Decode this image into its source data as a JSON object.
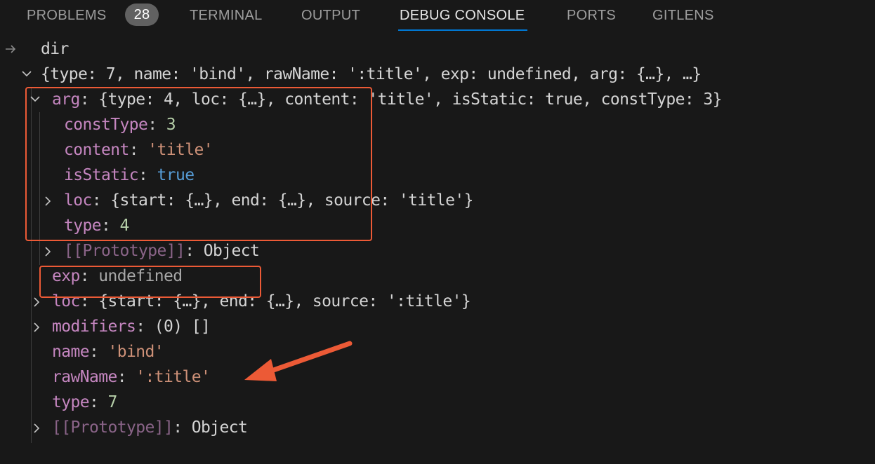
{
  "tabs": [
    {
      "label": "PROBLEMS",
      "badge": "28"
    },
    {
      "label": "TERMINAL"
    },
    {
      "label": "OUTPUT"
    },
    {
      "label": "DEBUG CONSOLE",
      "active": true
    },
    {
      "label": "PORTS"
    },
    {
      "label": "GITLENS"
    }
  ],
  "console": {
    "input": "dir",
    "lines": {
      "root": "{type: 7, name: 'bind', rawName: ':title', exp: undefined, arg: {…}, …}",
      "arg_key": "arg",
      "arg_summary": "{type: 4, loc: {…}, content: 'title', isStatic: true, constType: 3}",
      "arg_constType_key": "constType",
      "arg_constType_val": "3",
      "arg_content_key": "content",
      "arg_content_val": "'title'",
      "arg_isStatic_key": "isStatic",
      "arg_isStatic_val": "true",
      "arg_loc_key": "loc",
      "arg_loc_val": "{start: {…}, end: {…}, source: 'title'}",
      "arg_type_key": "type",
      "arg_type_val": "4",
      "arg_proto_key": "[[Prototype]]",
      "arg_proto_val": "Object",
      "exp_key": "exp",
      "exp_val": "undefined",
      "loc_key": "loc",
      "loc_val": "{start: {…}, end: {…}, source: ':title'}",
      "modifiers_key": "modifiers",
      "modifiers_val": "(0) []",
      "name_key": "name",
      "name_val": "'bind'",
      "rawName_key": "rawName",
      "rawName_val": "':title'",
      "type_key": "type",
      "type_val": "7",
      "proto_key": "[[Prototype]]",
      "proto_val": "Object"
    }
  },
  "colors": {
    "background": "#181818",
    "tab_active_underline": "#0078d4",
    "property_key": "#c586c0",
    "string_value": "#ce9178",
    "number_value": "#b5cea8",
    "boolean_value": "#569cd6",
    "annotation": "#ec5a36"
  }
}
